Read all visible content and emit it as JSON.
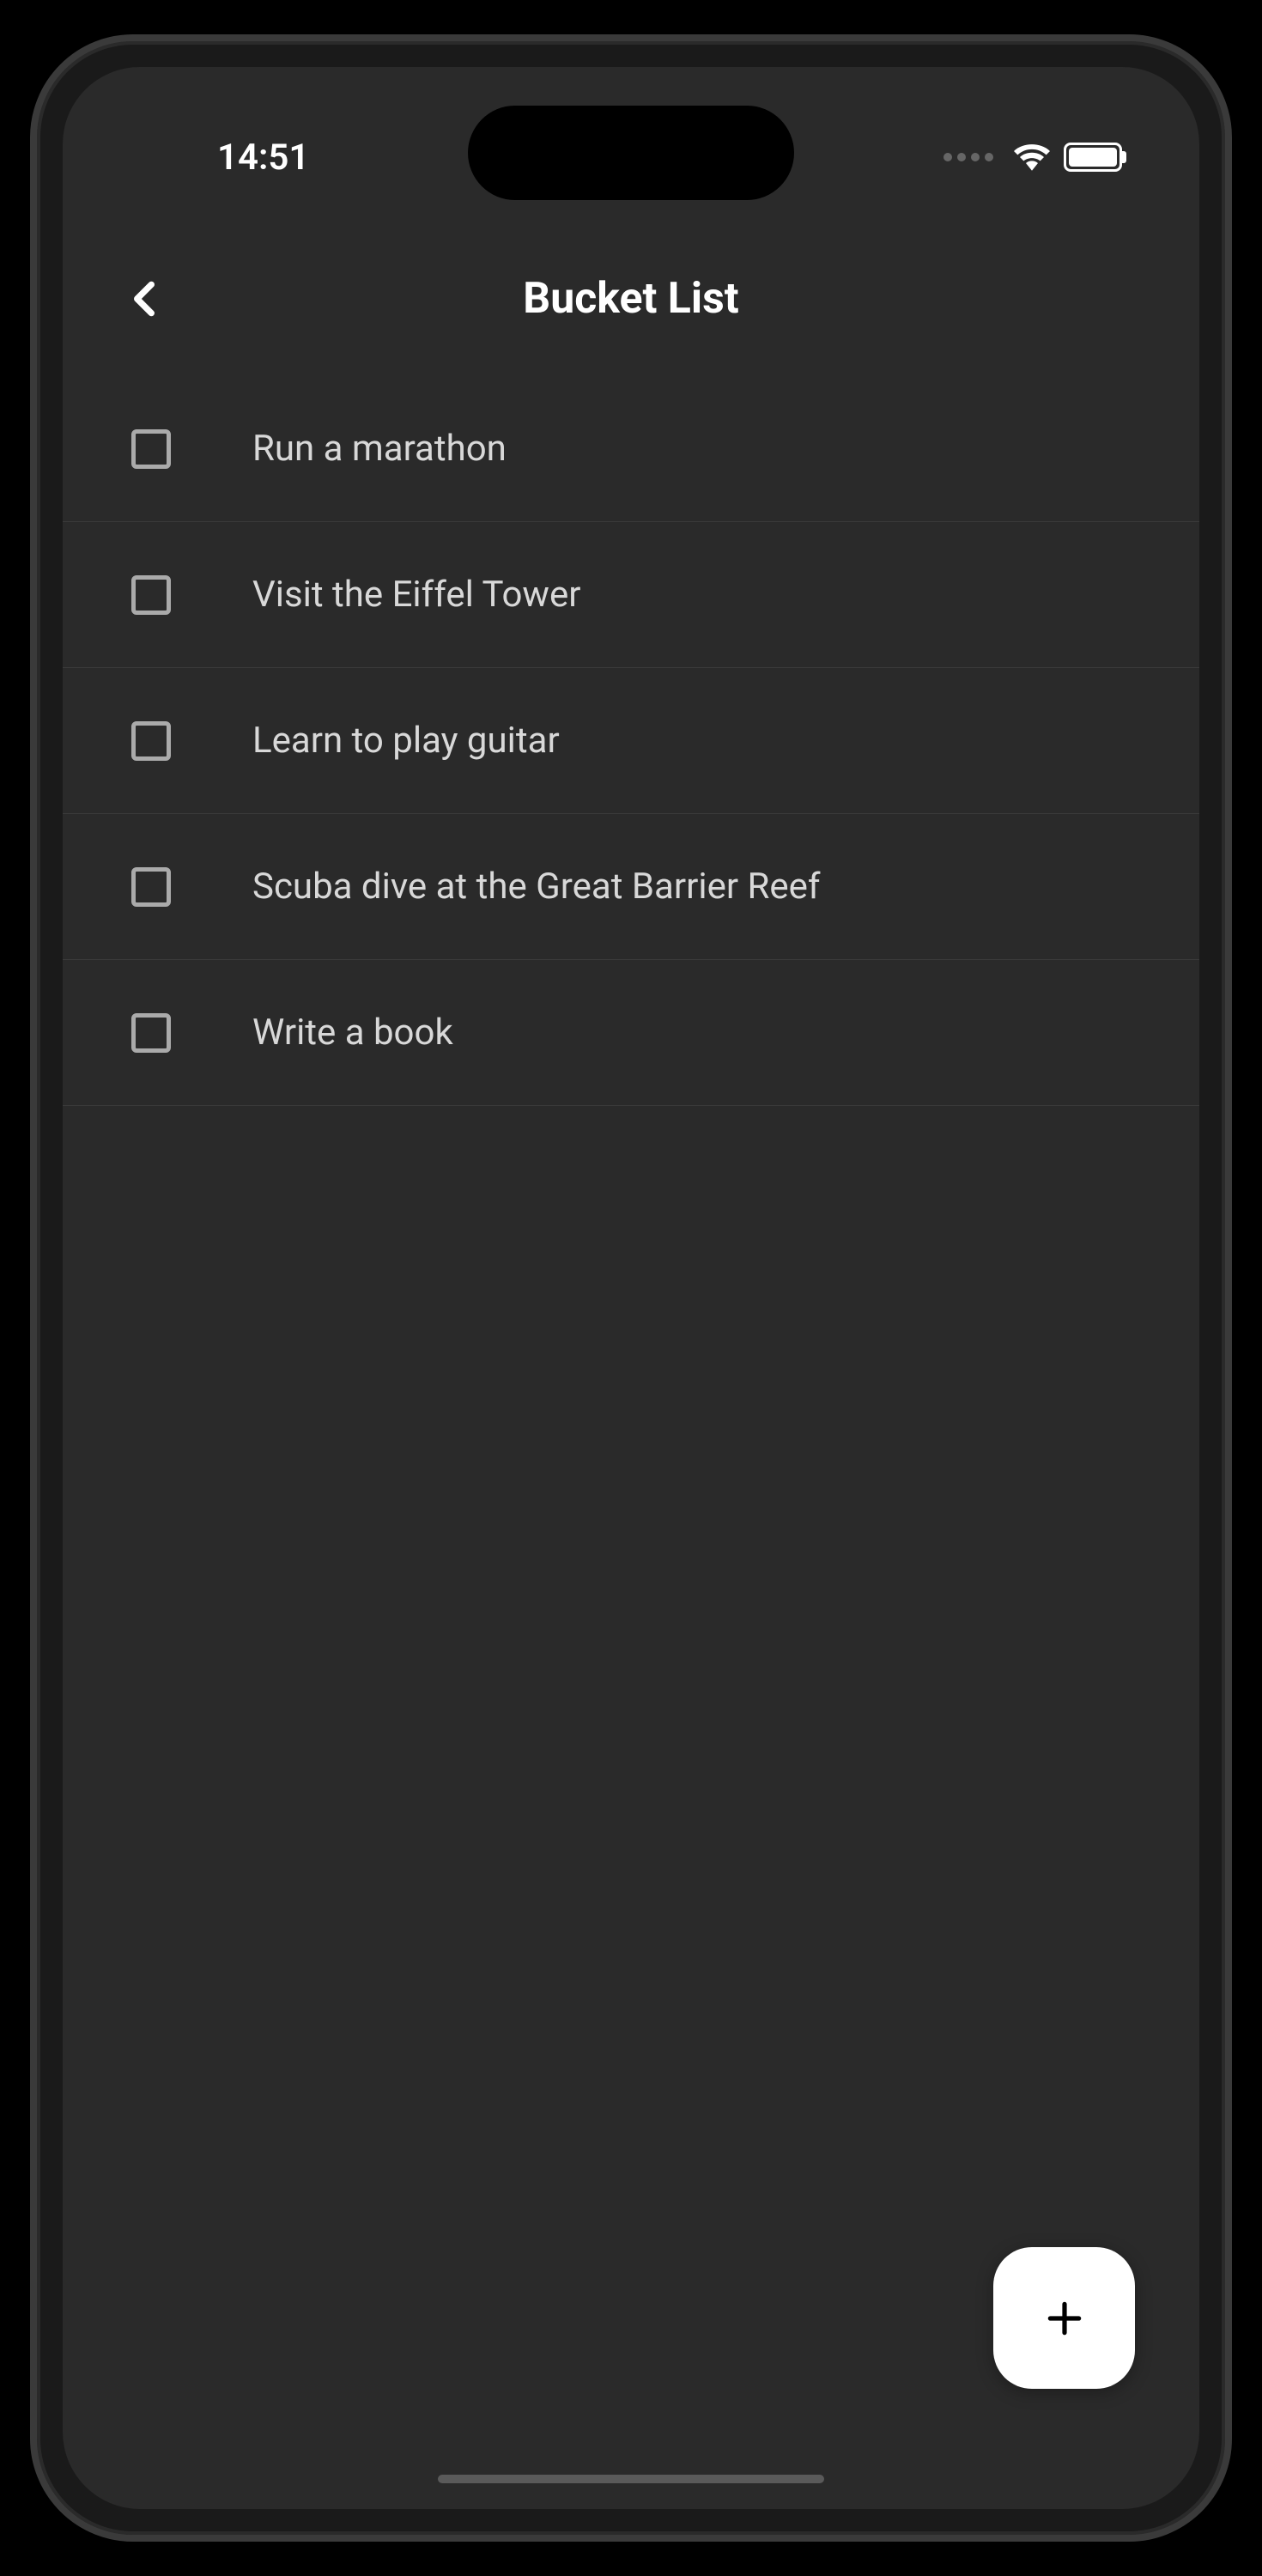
{
  "status_bar": {
    "time": "14:51"
  },
  "header": {
    "title": "Bucket List"
  },
  "list": {
    "items": [
      {
        "label": "Run a marathon",
        "checked": false
      },
      {
        "label": "Visit the Eiffel Tower",
        "checked": false
      },
      {
        "label": "Learn to play guitar",
        "checked": false
      },
      {
        "label": "Scuba dive at the Great Barrier Reef",
        "checked": false
      },
      {
        "label": "Write a book",
        "checked": false
      }
    ]
  },
  "icons": {
    "back": "chevron-left-icon",
    "add": "plus-icon",
    "wifi": "wifi-icon",
    "battery": "battery-icon"
  }
}
